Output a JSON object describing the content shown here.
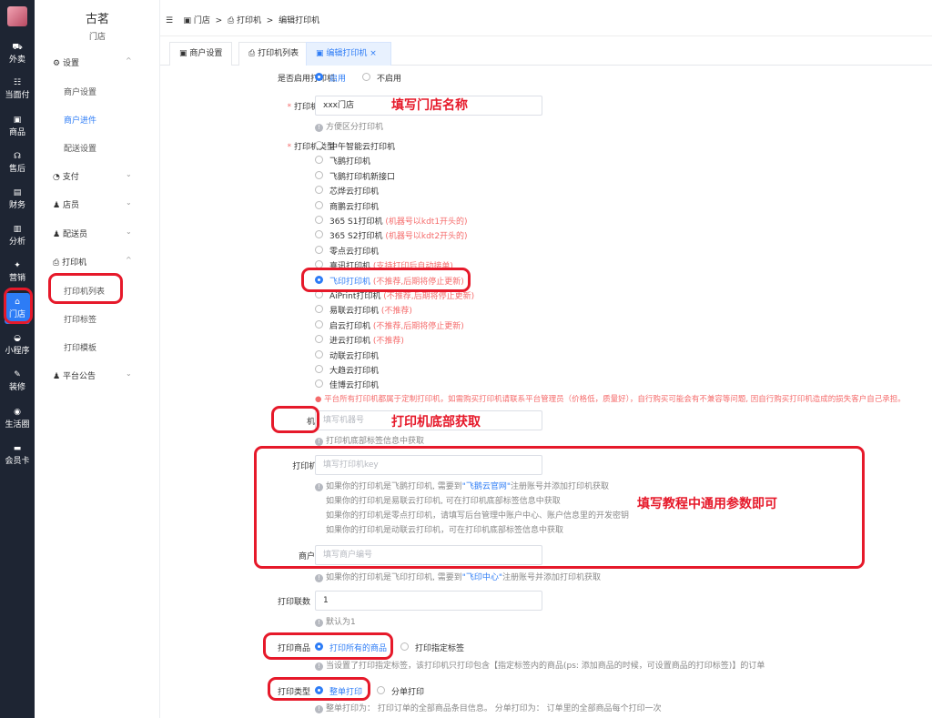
{
  "colors": {
    "accent": "#2d7cf6",
    "annotation": "#e6192a",
    "warning": "#f56c6c",
    "sidebar_bg": "#1e2533"
  },
  "leftbar": {
    "items": [
      {
        "icon": "bike-icon",
        "glyph": "⛟",
        "label": "外卖"
      },
      {
        "icon": "list-icon",
        "glyph": "☷",
        "label": "当面付"
      },
      {
        "icon": "shop-icon",
        "glyph": "▣",
        "label": "商品"
      },
      {
        "icon": "headset-icon",
        "glyph": "☊",
        "label": "售后"
      },
      {
        "icon": "wallet-icon",
        "glyph": "▤",
        "label": "财务"
      },
      {
        "icon": "chart-icon",
        "glyph": "▥",
        "label": "分析"
      },
      {
        "icon": "gift-icon",
        "glyph": "✦",
        "label": "营销"
      },
      {
        "icon": "store-icon",
        "glyph": "⌂",
        "label": "门店"
      },
      {
        "icon": "wechat-icon",
        "glyph": "◒",
        "label": "小程序"
      },
      {
        "icon": "brush-icon",
        "glyph": "✎",
        "label": "装修"
      },
      {
        "icon": "circle-icon",
        "glyph": "◉",
        "label": "生活圈"
      },
      {
        "icon": "card-icon",
        "glyph": "▬",
        "label": "会员卡"
      }
    ]
  },
  "submenu": {
    "store_name": "古茗",
    "store_sub": "门店",
    "groups": [
      {
        "icon": "gear-icon",
        "glyph": "⚙",
        "label": "设置",
        "chev": "^"
      },
      {
        "icon": "pay-icon",
        "glyph": "◔",
        "label": "支付",
        "chev": "⌄"
      },
      {
        "icon": "user-icon",
        "glyph": "♟",
        "label": "店员",
        "chev": "⌄"
      },
      {
        "icon": "delivery-icon",
        "glyph": "♟",
        "label": "配送员",
        "chev": "⌄"
      },
      {
        "icon": "printer-icon",
        "glyph": "⎙",
        "label": "打印机",
        "chev": "^"
      },
      {
        "icon": "notice-icon",
        "glyph": "♟",
        "label": "平台公告",
        "chev": "⌄"
      }
    ],
    "settings_items": [
      "商户设置",
      "商户进件",
      "配送设置"
    ],
    "printer_items": [
      "打印机列表",
      "打印标签",
      "打印模板"
    ]
  },
  "breadcrumb": {
    "collapse_glyph": "☰",
    "store_glyph": "▣",
    "printer_glyph": "⎙",
    "store": "门店",
    "sep": ">",
    "printer": "打印机",
    "current": "编辑打印机"
  },
  "tabs": [
    {
      "glyph": "▣",
      "label": "商户设置"
    },
    {
      "glyph": "⎙",
      "label": "打印机列表"
    },
    {
      "glyph": "▣",
      "label": "编辑打印机",
      "close": "×"
    }
  ],
  "form": {
    "enable": {
      "label": "是否启用打印机",
      "on": "启用",
      "off": "不启用"
    },
    "name": {
      "req": "*",
      "label": "打印机名称",
      "value": "xxx门店",
      "hint": "方便区分打印机"
    },
    "type": {
      "req": "*",
      "label": "打印机类型",
      "options": [
        {
          "name": "中午智能云打印机",
          "note": ""
        },
        {
          "name": "飞鹅打印机",
          "note": ""
        },
        {
          "name": "飞鹅打印机新接口",
          "note": ""
        },
        {
          "name": "芯烨云打印机",
          "note": ""
        },
        {
          "name": "商鹏云打印机",
          "note": ""
        },
        {
          "name": "365 S1打印机",
          "note": "(机器号以kdt1开头的)"
        },
        {
          "name": "365 S2打印机",
          "note": "(机器号以kdt2开头的)"
        },
        {
          "name": "零点云打印机",
          "note": ""
        },
        {
          "name": "喜讯打印机",
          "note": "(支持打印后自动接单)"
        },
        {
          "name": "飞印打印机",
          "note": "(不推荐,后期将停止更新)"
        },
        {
          "name": "AiPrint打印机",
          "note": "(不推荐,后期将停止更新)"
        },
        {
          "name": "易联云打印机",
          "note": "(不推荐)"
        },
        {
          "name": "启云打印机",
          "note": "(不推荐,后期将停止更新)"
        },
        {
          "name": "进云打印机",
          "note": "(不推荐)"
        },
        {
          "name": "动联云打印机",
          "note": ""
        },
        {
          "name": "大趋云打印机",
          "note": ""
        },
        {
          "name": "佳博云打印机",
          "note": ""
        }
      ],
      "selected_index": 9,
      "warning": "平台所有打印机都属于定制打印机，如需购买打印机请联系平台管理员（价格低，质量好），自行购买可能会有不兼容等问题, 因自行购买打印机造成的损失客户自己承担。"
    },
    "machine": {
      "label": "机器号",
      "placeholder": "填写机器号",
      "hint": "打印机底部标签信息中获取"
    },
    "key": {
      "label": "打印机key",
      "placeholder": "填写打印机key",
      "hint1_pre": "如果你的打印机是飞鹅打印机, 需要到",
      "hint1_link": "\"飞鹅云官网\"",
      "hint1_post": "注册账号并添加打印机获取",
      "hint2": "如果你的打印机是易联云打印机, 可在打印机底部标签信息中获取",
      "hint3": "如果你的打印机是零点打印机，请填写后台管理中账户中心、账户信息里的开发密钥",
      "hint4": "如果你的打印机是动联云打印机，可在打印机底部标签信息中获取"
    },
    "merchant": {
      "label": "商户编号",
      "placeholder": "填写商户编号",
      "hint_pre": "如果你的打印机是飞印打印机, 需要到",
      "hint_link": "\"飞印中心\"",
      "hint_post": "注册账号并添加打印机获取"
    },
    "copies": {
      "label": "打印联数",
      "value": "1",
      "hint": "默认为1"
    },
    "goods": {
      "label": "打印商品",
      "opt1": "打印所有的商品",
      "opt2": "打印指定标签",
      "hint": "当设置了打印指定标签，该打印机只打印包含【指定标签内的商品(ps: 添加商品的时候，可设置商品的打印标签)】的订单"
    },
    "print_type": {
      "label": "打印类型",
      "opt1": "整单打印",
      "opt2": "分单打印",
      "hint": "整单打印为： 打印订单的全部商品条目信息。 分单打印为： 订单里的全部商品每个打印一次"
    }
  },
  "annotations": {
    "a1": "填写门店名称",
    "a2": "打印机底部获取",
    "a3": "填写教程中通用参数即可"
  }
}
